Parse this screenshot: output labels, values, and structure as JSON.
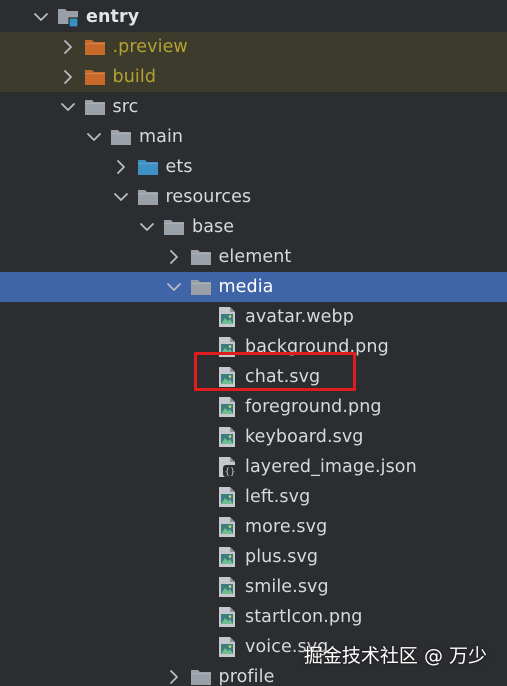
{
  "tree": {
    "items": [
      {
        "label": "entry",
        "depth": 0,
        "kind": "module",
        "expanded": true,
        "bold": true
      },
      {
        "label": ".preview",
        "depth": 1,
        "kind": "folder-orange",
        "expanded": false,
        "state": "excluded"
      },
      {
        "label": "build",
        "depth": 1,
        "kind": "folder-orange",
        "expanded": false,
        "state": "excluded"
      },
      {
        "label": "src",
        "depth": 1,
        "kind": "folder",
        "expanded": true
      },
      {
        "label": "main",
        "depth": 2,
        "kind": "folder",
        "expanded": true
      },
      {
        "label": "ets",
        "depth": 3,
        "kind": "folder-blue",
        "expanded": false
      },
      {
        "label": "resources",
        "depth": 3,
        "kind": "folder",
        "expanded": true
      },
      {
        "label": "base",
        "depth": 4,
        "kind": "folder",
        "expanded": true
      },
      {
        "label": "element",
        "depth": 5,
        "kind": "folder",
        "expanded": false
      },
      {
        "label": "media",
        "depth": 5,
        "kind": "folder",
        "expanded": true,
        "state": "selected"
      },
      {
        "label": "avatar.webp",
        "depth": 6,
        "kind": "image-file"
      },
      {
        "label": "background.png",
        "depth": 6,
        "kind": "image-file"
      },
      {
        "label": "chat.svg",
        "depth": 6,
        "kind": "image-file",
        "highlighted": true
      },
      {
        "label": "foreground.png",
        "depth": 6,
        "kind": "image-file"
      },
      {
        "label": "keyboard.svg",
        "depth": 6,
        "kind": "image-file"
      },
      {
        "label": "layered_image.json",
        "depth": 6,
        "kind": "json-file"
      },
      {
        "label": "left.svg",
        "depth": 6,
        "kind": "image-file"
      },
      {
        "label": "more.svg",
        "depth": 6,
        "kind": "image-file"
      },
      {
        "label": "plus.svg",
        "depth": 6,
        "kind": "image-file"
      },
      {
        "label": "smile.svg",
        "depth": 6,
        "kind": "image-file"
      },
      {
        "label": "startIcon.png",
        "depth": 6,
        "kind": "image-file"
      },
      {
        "label": "voice.svg",
        "depth": 6,
        "kind": "image-file"
      },
      {
        "label": "profile",
        "depth": 5,
        "kind": "folder",
        "expanded": false
      }
    ]
  },
  "watermark": "掘金技术社区 @ 万少",
  "colors": {
    "background": "#2b2d30",
    "selected_row": "#3f64a8",
    "excluded_row": "#3d3b2c",
    "excluded_text": "#b4a22f",
    "text": "#d7d9dc",
    "folder_gray": "#9aa0a8",
    "folder_orange": "#c8692a",
    "folder_blue": "#3d8fc4",
    "highlight_box": "#e01c1c"
  }
}
